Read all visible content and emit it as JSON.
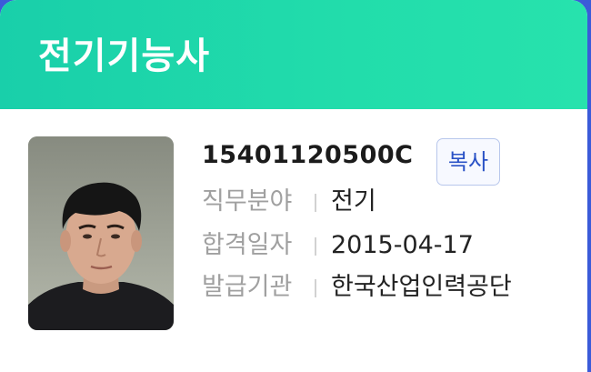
{
  "card": {
    "title": "전기기능사",
    "license_number": "15401120500C",
    "copy_button_label": "복사",
    "fields": [
      {
        "label": "직무분야",
        "value": "전기"
      },
      {
        "label": "합격일자",
        "value": "2015-04-17"
      },
      {
        "label": "발급기관",
        "value": "한국산업인력공단"
      }
    ]
  },
  "colors": {
    "header": "#22ddab",
    "copy_button_text": "#2a52c6",
    "frame_background": "#3b5bd9"
  },
  "icons": {
    "photo": "profile-photo"
  }
}
